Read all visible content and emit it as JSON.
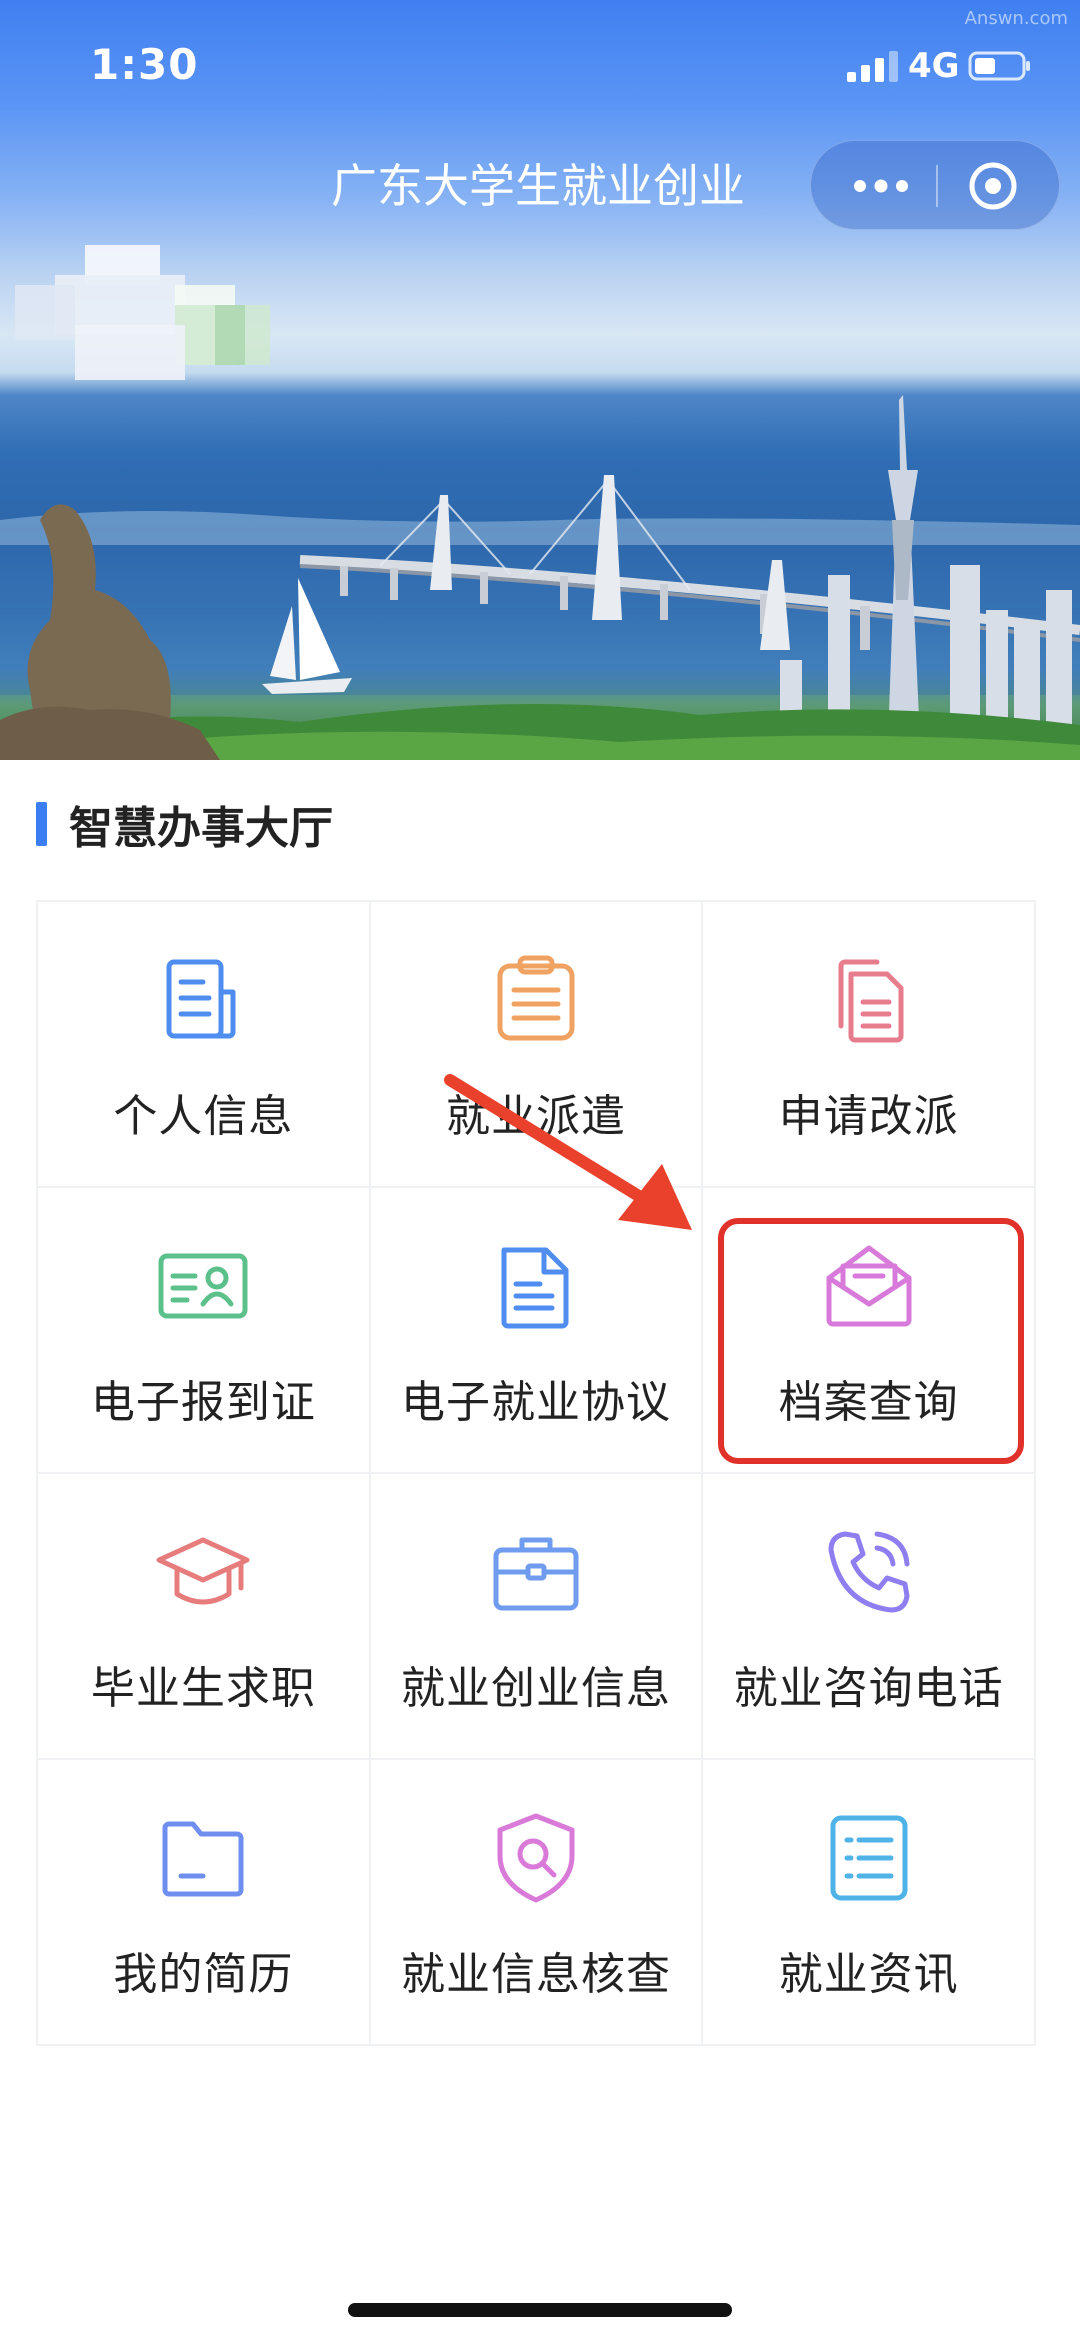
{
  "status_bar": {
    "time": "1:30",
    "network": "4G"
  },
  "header": {
    "title": "广东大学生就业创业"
  },
  "watermark": "Answn.com",
  "section": {
    "title": "智慧办事大厅"
  },
  "services": [
    {
      "label": "个人信息",
      "icon": "profile-document-icon",
      "color": "#4f8ef0"
    },
    {
      "label": "就业派遣",
      "icon": "clipboard-list-icon",
      "color": "#f0a262"
    },
    {
      "label": "申请改派",
      "icon": "copy-documents-icon",
      "color": "#e77c8c"
    },
    {
      "label": "电子报到证",
      "icon": "id-card-icon",
      "color": "#5cc08a"
    },
    {
      "label": "电子就业协议",
      "icon": "agreement-document-icon",
      "color": "#4f8ef0"
    },
    {
      "label": "档案查询",
      "icon": "open-envelope-icon",
      "color": "#d77ad9"
    },
    {
      "label": "毕业生求职",
      "icon": "graduation-cap-icon",
      "color": "#e77c7c"
    },
    {
      "label": "就业创业信息",
      "icon": "briefcase-icon",
      "color": "#6f9cee"
    },
    {
      "label": "就业咨询电话",
      "icon": "phone-call-icon",
      "color": "#8f7ef0"
    },
    {
      "label": "我的简历",
      "icon": "folder-icon",
      "color": "#6f8ff0"
    },
    {
      "label": "就业信息核查",
      "icon": "shield-search-icon",
      "color": "#d97ad9"
    },
    {
      "label": "就业资讯",
      "icon": "list-document-icon",
      "color": "#4fb3e8"
    }
  ],
  "highlighted_item": "档案查询"
}
